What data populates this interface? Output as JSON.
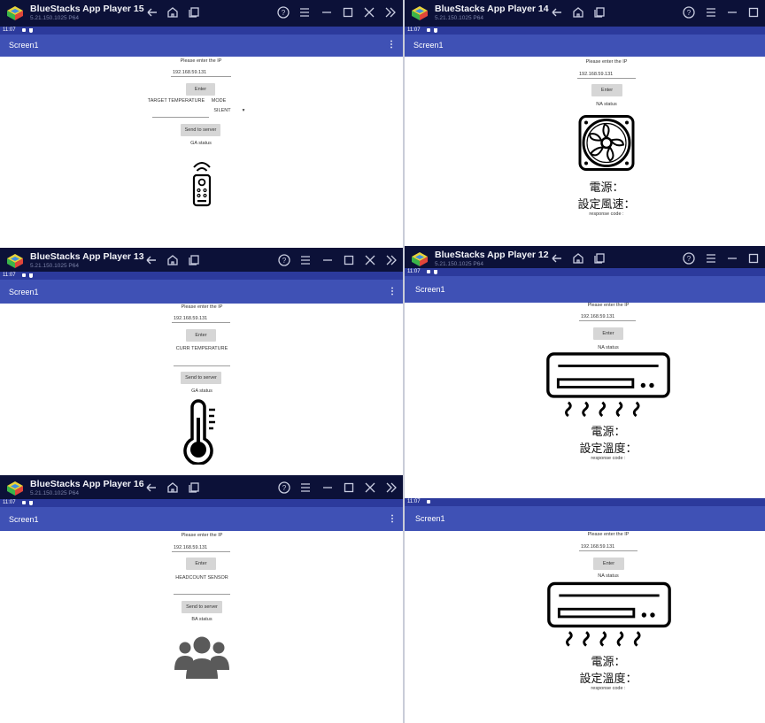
{
  "windows": {
    "w15": {
      "title": "BlueStacks App Player 15",
      "version": "5.21.150.1025 P64",
      "time": "11:07",
      "screen_title": "Screen1",
      "menu": "⋮",
      "prompt": "Please enter the IP",
      "ip": "192.168.59.131",
      "enter": "Enter",
      "target_label": "TARGET TEMPERATURE",
      "mode_label": "MODE",
      "mode_value": "SILENT",
      "mode_arrow": "▾",
      "send": "Send to server",
      "status": "GA status"
    },
    "w14": {
      "title": "BlueStacks App Player 14",
      "version": "5.21.150.1025 P64",
      "time": "11:07",
      "screen_title": "Screen1",
      "prompt": "Please enter the IP",
      "ip": "192.168.59.131",
      "enter": "Enter",
      "status": "NA status",
      "power": "電源：",
      "speed": "設定風速：",
      "response": "response code :"
    },
    "w13": {
      "title": "BlueStacks App Player 13",
      "version": "5.21.150.1025 P64",
      "time": "11:07",
      "screen_title": "Screen1",
      "menu": "⋮",
      "prompt": "Please enter the IP",
      "ip": "192.168.59.131",
      "enter": "Enter",
      "curr_label": "CURR TEMPERATURE",
      "send": "Send to server",
      "status": "GA status"
    },
    "w12": {
      "title": "BlueStacks App Player 12",
      "version": "5.21.150.1025 P64",
      "time": "11:07",
      "screen_title": "Screen1",
      "prompt": "Please enter the IP",
      "ip": "192.168.59.131",
      "enter": "Enter",
      "status": "NA status",
      "power": "電源：",
      "temp": "設定溫度：",
      "response": "response code :"
    },
    "w16": {
      "title": "BlueStacks App Player 16",
      "version": "5.21.150.1025 P64",
      "time": "11:07",
      "screen_title": "Screen1",
      "menu": "⋮",
      "prompt": "Please enter the IP",
      "ip": "192.168.59.131",
      "enter": "Enter",
      "head_label": "HEADCOUNT SENSOR",
      "send": "Send to server",
      "status": "BA status"
    },
    "w6": {
      "time": "11:07",
      "screen_title": "Screen1",
      "prompt": "Please enter the IP",
      "ip": "192.168.59.131",
      "enter": "Enter",
      "status": "NA status",
      "power": "電源：",
      "temp": "設定溫度：",
      "response": "response code :"
    }
  },
  "icons": {
    "titlebar": [
      "back-arrow-icon",
      "home-icon",
      "recent-apps-icon",
      "help-icon",
      "menu-icon",
      "minimize-icon",
      "maximize-icon",
      "close-icon",
      "expand-icon"
    ],
    "content": [
      "remote-control-icon",
      "fan-icon",
      "thermometer-icon",
      "air-conditioner-icon",
      "people-group-icon"
    ]
  },
  "colors": {
    "titlebar": "#0c1138",
    "statusbar": "#2c3a9c",
    "appbar": "#3f51b5",
    "button": "#d6d6d6",
    "people": "#5a5a5a"
  }
}
